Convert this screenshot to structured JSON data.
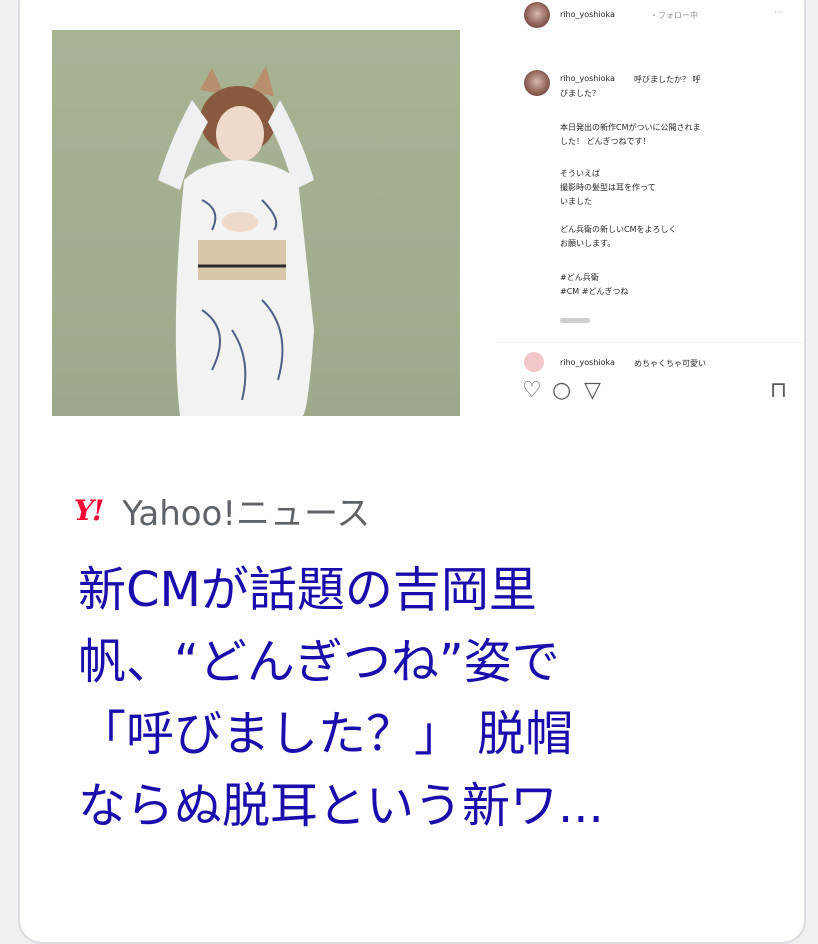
{
  "instagram_post": {
    "username": "riho_yoshioka",
    "follow_label": "・フォロー中",
    "more_label": "···",
    "caption_username": "riho_yoshioka",
    "caption_lines": [
      "呼びましたか？ 呼",
      "びました？",
      "本日発出の新作CMがついに公開されま",
      "した！ どんぎつねです！",
      "そういえば",
      "撮影時の髪型は耳を作って",
      "いました",
      "どん兵衛の新しいCMをよろしく",
      "お願いします。",
      "#どん兵衛",
      "#CM #どんぎつね"
    ],
    "comment_username": "riho_yoshioka",
    "comment_text": "めちゃくちゃ可愛い"
  },
  "source": {
    "logo": "Y!",
    "name": "Yahoo!ニュース"
  },
  "headline": {
    "lines": [
      "新CMが話題の吉岡里",
      "帆、“どんぎつね”姿で",
      "「呼びました？」 脱帽",
      "ならぬ脱耳という新ワ..."
    ]
  },
  "icons": {
    "heart": "heart-icon",
    "comment": "comment-icon",
    "share": "share-icon",
    "bookmark": "bookmark-icon"
  },
  "colors": {
    "headline": "#1a0dab",
    "yahoo_red": "#ff0033",
    "source_grey": "#5f6368"
  }
}
